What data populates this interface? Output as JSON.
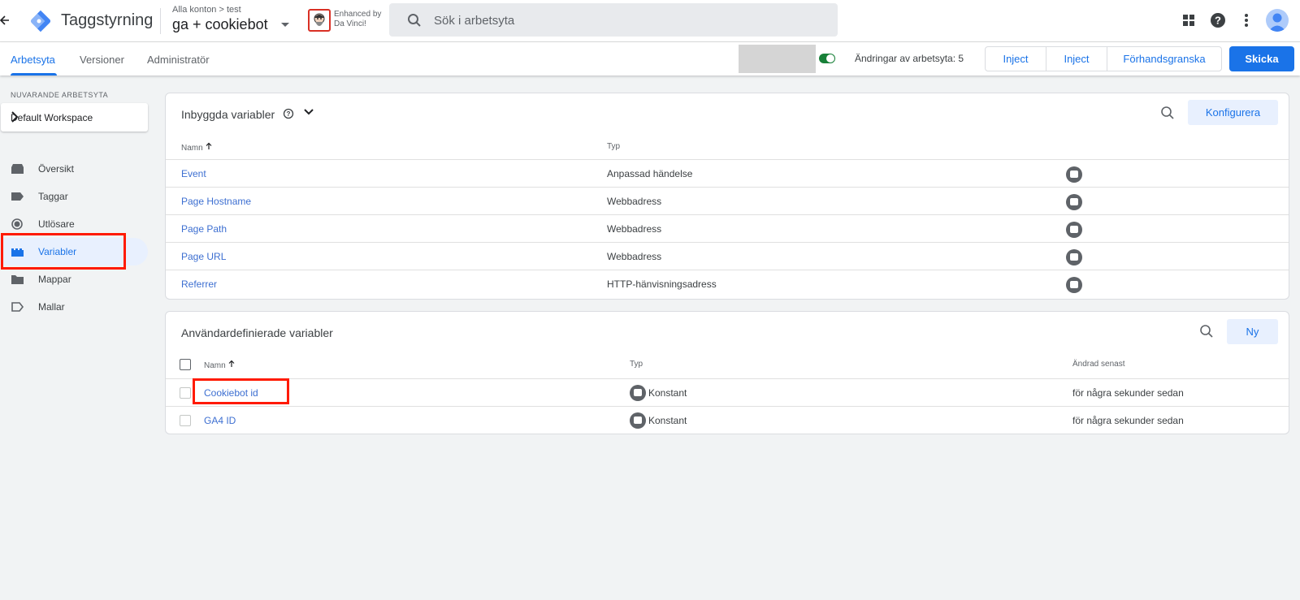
{
  "header": {
    "back_icon": "arrow-left-icon",
    "app_title": "Taggstyrning",
    "breadcrumb_root": "Alla konton",
    "breadcrumb_sep": ">",
    "breadcrumb_account": "test",
    "container_name": "ga + cookiebot",
    "extension_line1": "Enhanced by",
    "extension_line2": "Da Vinci!",
    "search_placeholder": "Sök i arbetsyta",
    "brand_color": "#1a73e8"
  },
  "subnav": {
    "tabs": [
      {
        "label": "Arbetsyta",
        "active": true
      },
      {
        "label": "Versioner",
        "active": false
      },
      {
        "label": "Administratör",
        "active": false
      }
    ],
    "changes_label": "Ändringar av arbetsyta: 5",
    "inject1": "Inject",
    "inject2": "Inject",
    "preview": "Förhandsgranska",
    "submit": "Skicka"
  },
  "sidebar": {
    "workspace_label": "NUVARANDE ARBETSYTA",
    "workspace_name": "Default Workspace",
    "items": [
      {
        "label": "Översikt",
        "icon": "overview-icon"
      },
      {
        "label": "Taggar",
        "icon": "tag-icon"
      },
      {
        "label": "Utlösare",
        "icon": "trigger-icon"
      },
      {
        "label": "Variabler",
        "icon": "variables-icon",
        "active": true
      },
      {
        "label": "Mappar",
        "icon": "folder-icon"
      },
      {
        "label": "Mallar",
        "icon": "template-icon"
      }
    ]
  },
  "builtin": {
    "title": "Inbyggda variabler",
    "configure": "Konfigurera",
    "col_name": "Namn",
    "col_type": "Typ",
    "rows": [
      {
        "name": "Event",
        "type": "Anpassad händelse"
      },
      {
        "name": "Page Hostname",
        "type": "Webbadress"
      },
      {
        "name": "Page Path",
        "type": "Webbadress"
      },
      {
        "name": "Page URL",
        "type": "Webbadress"
      },
      {
        "name": "Referrer",
        "type": "HTTP-hänvisningsadress"
      }
    ]
  },
  "userdefined": {
    "title": "Användardefinierade variabler",
    "new": "Ny",
    "col_name": "Namn",
    "col_type": "Typ",
    "col_changed": "Ändrad senast",
    "rows": [
      {
        "name": "Cookiebot id",
        "type": "Konstant",
        "changed": "för några sekunder sedan"
      },
      {
        "name": "GA4 ID",
        "type": "Konstant",
        "changed": "för några sekunder sedan"
      }
    ]
  }
}
